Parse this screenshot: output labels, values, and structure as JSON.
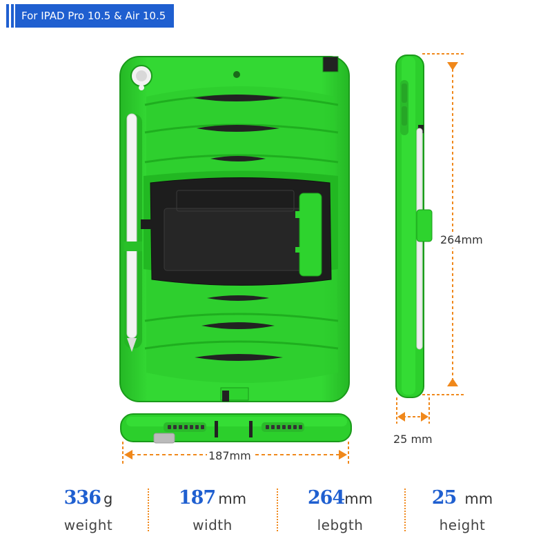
{
  "header": {
    "title": "For IPAD Pro 10.5 & Air 10.5"
  },
  "colors": {
    "accent": "#1f5fd0",
    "case_green": "#2fd62f",
    "dimension_orange": "#f0881b"
  },
  "dimensions": {
    "length_label": "264mm",
    "thickness_label": "25 mm",
    "width_label": "187mm"
  },
  "specs": [
    {
      "value": "336",
      "unit": "g",
      "label": "weight"
    },
    {
      "value": "187",
      "unit": "mm",
      "label": "width"
    },
    {
      "value": "264",
      "unit": "mm",
      "label": "lebgth"
    },
    {
      "value": "25",
      "unit": "mm",
      "label": "height"
    }
  ]
}
